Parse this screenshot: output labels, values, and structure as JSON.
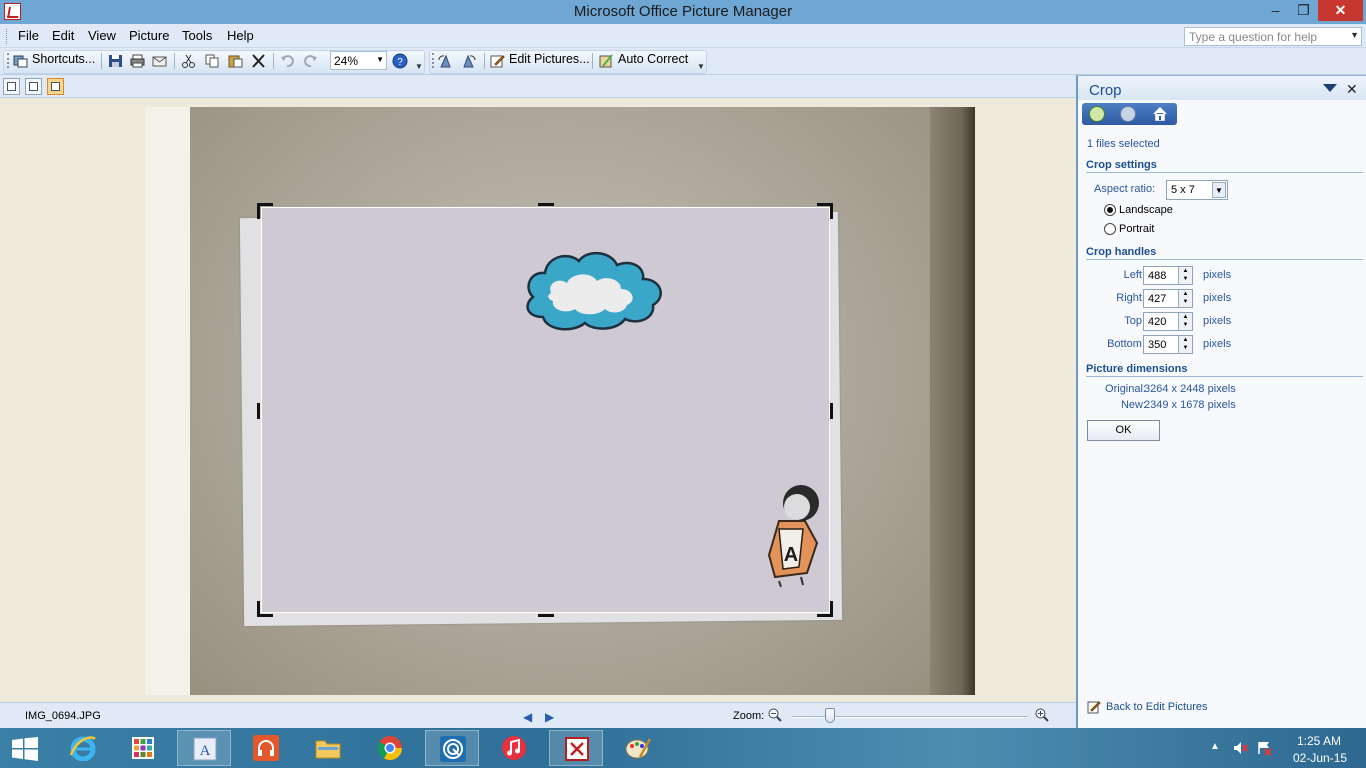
{
  "window": {
    "title": "Microsoft Office Picture Manager",
    "controls": {
      "minimize": "–",
      "maximize": "❐",
      "close": "✕"
    }
  },
  "menu": {
    "items": [
      "File",
      "Edit",
      "View",
      "Picture",
      "Tools",
      "Help"
    ],
    "help_placeholder": "Type a question for help"
  },
  "toolbar": {
    "shortcuts_label": "Shortcuts...",
    "zoom_value": "24%",
    "edit_pictures_label": "Edit Pictures...",
    "auto_correct_label": "Auto Correct"
  },
  "status": {
    "filename": "IMG_0694.JPG",
    "zoom_label": "Zoom:"
  },
  "task_pane": {
    "title": "Crop",
    "files_selected": "1 files selected",
    "crop_settings_heading": "Crop settings",
    "aspect_ratio_label": "Aspect ratio:",
    "aspect_ratio_value": "5 x 7",
    "orientation_options": [
      "Landscape",
      "Portrait"
    ],
    "orientation_selected": "Landscape",
    "crop_handles_heading": "Crop handles",
    "handles": [
      {
        "label": "Left:",
        "value": "488",
        "unit": "pixels"
      },
      {
        "label": "Right:",
        "value": "427",
        "unit": "pixels"
      },
      {
        "label": "Top:",
        "value": "420",
        "unit": "pixels"
      },
      {
        "label": "Bottom:",
        "value": "350",
        "unit": "pixels"
      }
    ],
    "dimensions_heading": "Picture dimensions",
    "original_label": "Original:",
    "original_value": "3264 x 2448 pixels",
    "new_label": "New:",
    "new_value": "2349 x 1678 pixels",
    "ok_label": "OK",
    "back_link": "Back to Edit Pictures"
  },
  "taskbar": {
    "time": "1:25 AM",
    "date": "02-Jun-15",
    "apps": [
      "start",
      "internet-explorer",
      "metro-apps",
      "word",
      "headphones",
      "file-explorer",
      "chrome",
      "media",
      "itunes",
      "picture-manager",
      "paint"
    ]
  }
}
